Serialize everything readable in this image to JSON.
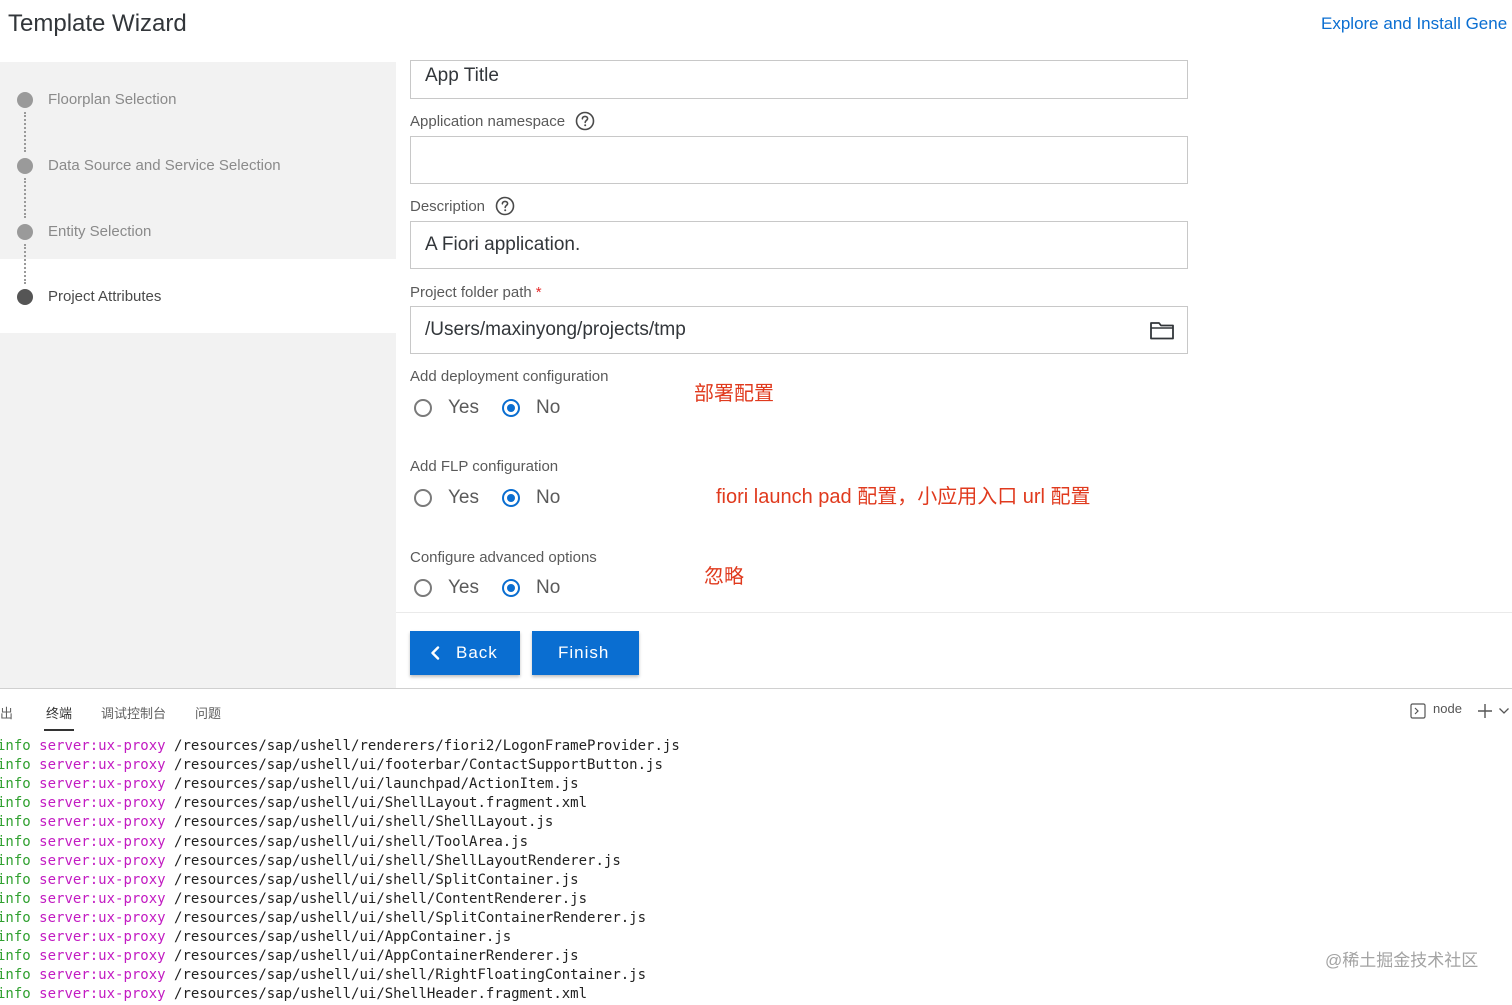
{
  "header": {
    "title": "Template Wizard",
    "explore_link": "Explore and Install Gene"
  },
  "steps": [
    {
      "label": "Floorplan Selection",
      "state": "done"
    },
    {
      "label": "Data Source and Service Selection",
      "state": "done"
    },
    {
      "label": "Entity Selection",
      "state": "done"
    },
    {
      "label": "Project Attributes",
      "state": "current"
    }
  ],
  "form": {
    "app_title_value": "App Title",
    "namespace_label": "Application namespace",
    "namespace_value": "",
    "description_label": "Description",
    "description_value": "A Fiori application.",
    "folder_label": "Project folder path",
    "required_mark": "*",
    "folder_value": "/Users/maxinyong/projects/tmp",
    "deployment": {
      "label": "Add deployment configuration",
      "yes": "Yes",
      "no": "No",
      "selected": "No"
    },
    "flp": {
      "label": "Add FLP configuration",
      "yes": "Yes",
      "no": "No",
      "selected": "No"
    },
    "advanced": {
      "label": "Configure advanced options",
      "yes": "Yes",
      "no": "No",
      "selected": "No"
    }
  },
  "annotations": {
    "deployment": "部署配置",
    "flp": "fiori launch pad 配置，小应用入口 url 配置",
    "advanced": "忽略"
  },
  "buttons": {
    "back": "Back",
    "finish": "Finish"
  },
  "terminal": {
    "tabs": [
      "输出",
      "终端",
      "调试控制台",
      "问题"
    ],
    "active_tab": "终端",
    "shell_label": "node",
    "level": "info",
    "source": "server:ux-proxy",
    "lines": [
      "/resources/sap/ushell/renderers/fiori2/LogonFrameProvider.js",
      "/resources/sap/ushell/ui/footerbar/ContactSupportButton.js",
      "/resources/sap/ushell/ui/launchpad/ActionItem.js",
      "/resources/sap/ushell/ui/ShellLayout.fragment.xml",
      "/resources/sap/ushell/ui/shell/ShellLayout.js",
      "/resources/sap/ushell/ui/shell/ToolArea.js",
      "/resources/sap/ushell/ui/shell/ShellLayoutRenderer.js",
      "/resources/sap/ushell/ui/shell/SplitContainer.js",
      "/resources/sap/ushell/ui/shell/ContentRenderer.js",
      "/resources/sap/ushell/ui/shell/SplitContainerRenderer.js",
      "/resources/sap/ushell/ui/AppContainer.js",
      "/resources/sap/ushell/ui/AppContainerRenderer.js",
      "/resources/sap/ushell/ui/shell/RightFloatingContainer.js",
      "/resources/sap/ushell/ui/ShellHeader.fragment.xml"
    ],
    "watermark": "@稀土掘金技术社区"
  }
}
